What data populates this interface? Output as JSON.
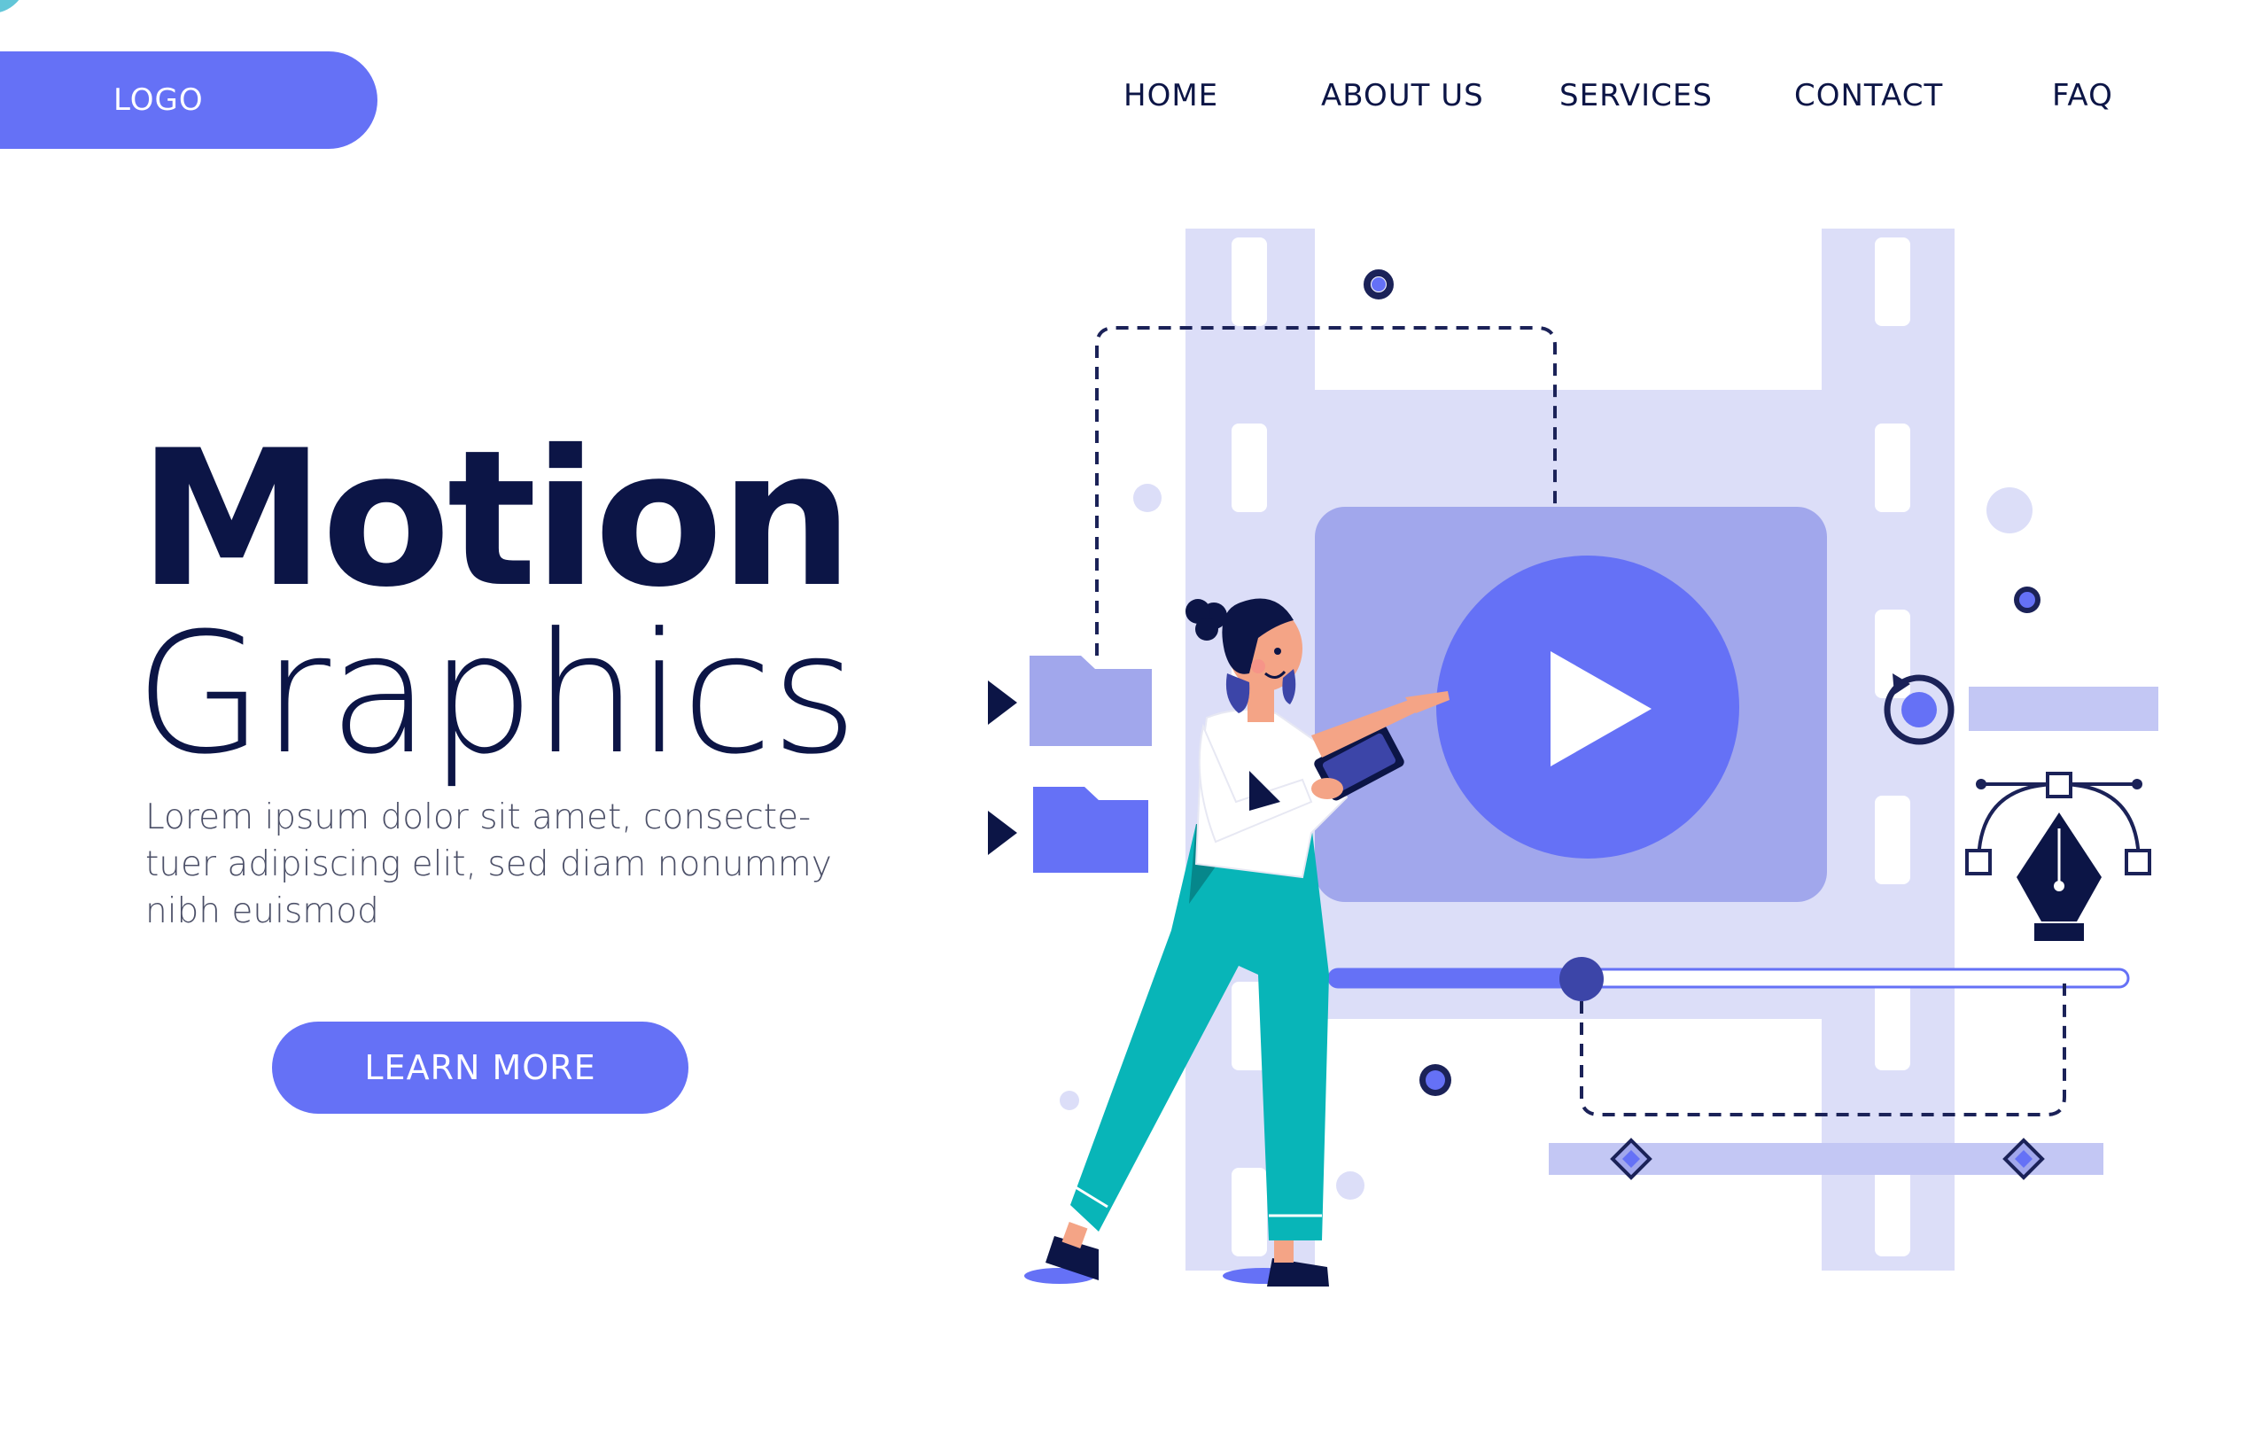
{
  "header": {
    "logo_label": "LOGO",
    "nav": [
      {
        "label": "HOME"
      },
      {
        "label": "ABOUT US"
      },
      {
        "label": "SERVICES"
      },
      {
        "label": "CONTACT"
      },
      {
        "label": "FAQ"
      }
    ]
  },
  "hero": {
    "title": "Motion",
    "subtitle": "Graphics",
    "body": "Lorem ipsum dolor sit amet, consecte-tuer adipiscing elit, sed diam nonummy nibh euismod",
    "body_lines": [
      "Lorem ipsum dolor sit amet, consecte-",
      "tuer adipiscing elit, sed diam nonummy",
      "nibh euismod"
    ],
    "cta_label": "LEARN MORE"
  },
  "illustration": {
    "icons": [
      "play-icon",
      "folder-icon",
      "pen-tool-icon",
      "rotate-icon",
      "keyframe-icon"
    ],
    "timeline_progress": 0.32
  },
  "colors": {
    "accent": "#6571f6",
    "navy": "#0c1546",
    "lavender": "#dcdef8",
    "lavender_mid": "#a1a7ec",
    "teal": "#08b5b8"
  }
}
